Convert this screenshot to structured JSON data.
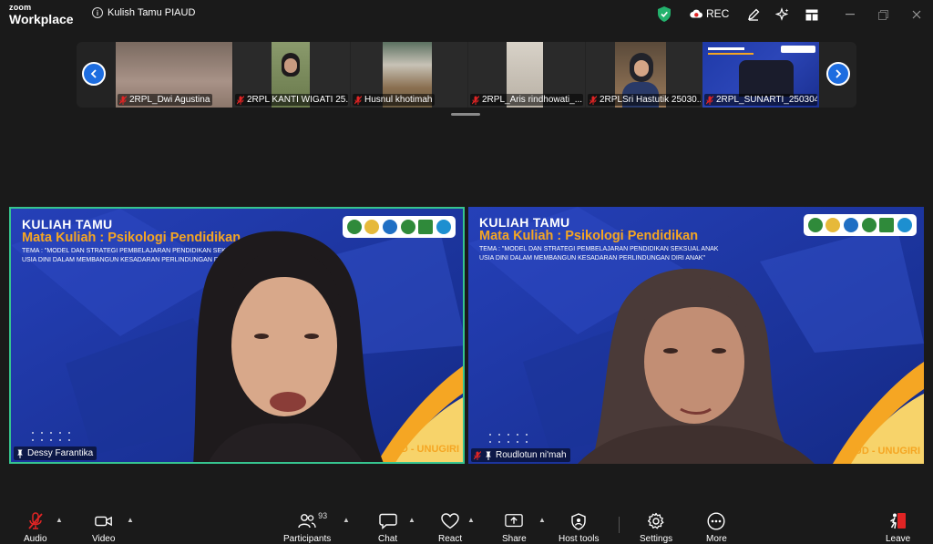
{
  "app": {
    "brand_top": "zoom",
    "brand_bottom": "Workplace",
    "meeting_title": "Kulish Tamu PIAUD",
    "rec_label": "REC",
    "colors": {
      "accent": "#1d6de0",
      "active_speaker": "#36c48f",
      "shield": "#23b26d",
      "rec": "#e02424"
    }
  },
  "filmstrip": {
    "participants": [
      {
        "name": "2RPL_Dwi Agustina",
        "muted": true
      },
      {
        "name": "2RPL KANTI WIGATI 25...",
        "muted": true
      },
      {
        "name": "Husnul khotimah",
        "muted": true
      },
      {
        "name": "2RPL_Aris rindhowati_...",
        "muted": true
      },
      {
        "name": "2RPLSri Hastutik 25030...",
        "muted": true
      },
      {
        "name": "2RPL_SUNARTI_250304...",
        "muted": true
      }
    ]
  },
  "tiles": [
    {
      "name": "Dessy Farantika",
      "pinned": true,
      "active": true,
      "bg_title": "KULIAH TAMU",
      "bg_subtitle": "Mata Kuliah : Psikologi Pendidikan",
      "bg_theme": "TEMA : \"MODEL DAN STRATEGI PEMBELAJARAN PENDIDIKAN SEKSUAL ANAK USIA DINI DALAM MEMBANGUN KESADARAN PERLINDUNGAN DIRI ANAK\"",
      "bg_brand": "UD - UNUGIRI"
    },
    {
      "name": "Roudlotun ni'mah",
      "pinned": true,
      "muted": true,
      "active": false,
      "bg_title": "KULIAH TAMU",
      "bg_subtitle": "Mata Kuliah : Psikologi Pendidikan",
      "bg_theme": "TEMA : \"MODEL DAN STRATEGI PEMBELAJARAN PENDIDIKAN SEKSUAL ANAK USIA DINI DALAM MEMBANGUN KESADARAN PERLINDUNGAN DIRI ANAK\"",
      "bg_brand": "UD - UNUGIRI"
    }
  ],
  "toolbar": {
    "audio": "Audio",
    "video": "Video",
    "participants": "Participants",
    "participants_count": "93",
    "chat": "Chat",
    "react": "React",
    "share": "Share",
    "host_tools": "Host tools",
    "settings": "Settings",
    "more": "More",
    "leave": "Leave"
  }
}
